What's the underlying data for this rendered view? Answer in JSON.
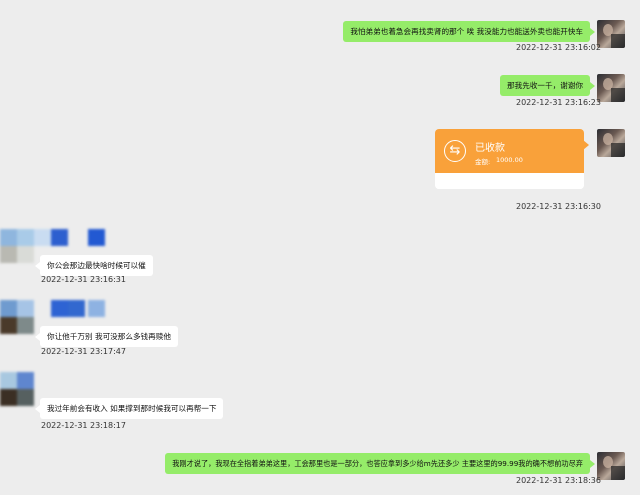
{
  "messages": [
    {
      "text": "我怕弟弟也着急会再找卖肾的那个 唉 我没能力也能送外卖也能开快车",
      "time": "2022-12-31 23:16:02"
    },
    {
      "text": "那我先收一千，谢谢你",
      "time": "2022-12-31 23:16:23"
    },
    {
      "time": "2022-12-31 23:16:30"
    },
    {
      "text": "你公会那边最快啥时候可以催",
      "time": "2022-12-31 23:16:31"
    },
    {
      "text": "你让他千万别 我可没那么多钱再赎他",
      "time": "2022-12-31 23:17:47"
    },
    {
      "text": "我过年前会有收入 如果撑到那时候我可以再帮一下",
      "time": "2022-12-31 23:18:17"
    },
    {
      "text": "我刚才说了，我现在全指着弟弟这里，工会那里也是一部分，也答应拿到多少给m先还多少 主要这里的99.99我的确不想前功尽弃",
      "time": "2022-12-31 23:18:36"
    }
  ],
  "transfer": {
    "icon": "transfer-arrows-icon",
    "status": "已收款",
    "amount_label": "金额:",
    "amount": "1000.00"
  },
  "colors": {
    "background": "#ededed",
    "my_bubble": "#95ec69",
    "other_bubble": "#ffffff",
    "transfer_card": "#f9a13a"
  }
}
